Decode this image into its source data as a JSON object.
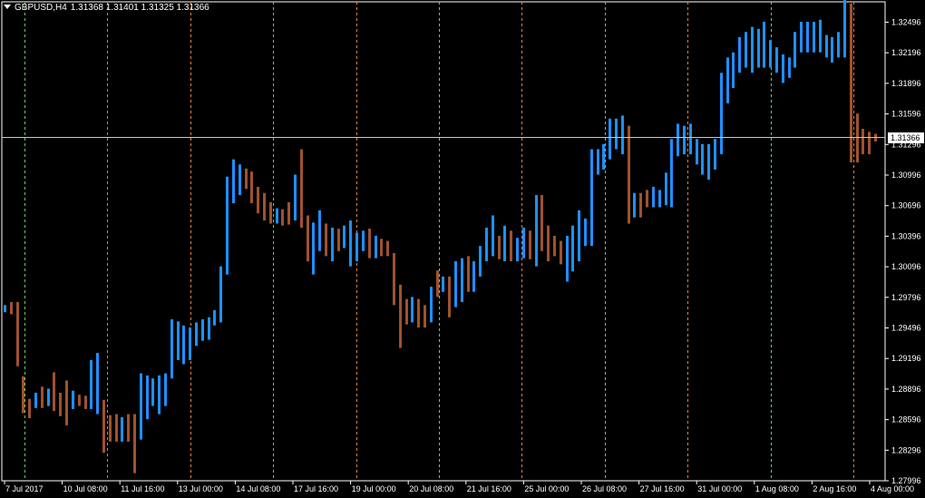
{
  "window": {
    "symbol": "GBPUSD,H4",
    "ohlc_label": "1.31368 1.31401 1.31325 1.31366"
  },
  "current_price": "1.31366",
  "colors": {
    "background": "#000000",
    "bull": "#1E90FF",
    "bear": "#A0522D",
    "axis": "#FFFFFF",
    "separator_green": "#66CC66",
    "separator_orange": "#E08040"
  },
  "chart_data": {
    "type": "ohlc-bars",
    "symbol": "GBPUSD",
    "timeframe": "H4",
    "ylim": [
      1.27996,
      1.32696
    ],
    "y_ticks": [
      "1.32496",
      "1.32196",
      "1.31896",
      "1.31596",
      "1.31296",
      "1.30996",
      "1.30696",
      "1.30396",
      "1.30096",
      "1.29796",
      "1.29496",
      "1.29196",
      "1.28896",
      "1.28596",
      "1.28296",
      "1.27996"
    ],
    "x_ticks": [
      "7 Jul 2017",
      "10 Jul 08:00",
      "11 Jul 16:00",
      "13 Jul 00:00",
      "14 Jul 08:00",
      "17 Jul 16:00",
      "19 Jul 00:00",
      "20 Jul 08:00",
      "21 Jul 16:00",
      "25 Jul 00:00",
      "26 Jul 08:00",
      "27 Jul 16:00",
      "31 Jul 00:00",
      "1 Aug 08:00",
      "2 Aug 16:00",
      "4 Aug 00:00"
    ],
    "separators": [
      "green",
      "orange",
      "orange",
      "green",
      "orange",
      "green",
      "orange",
      "green",
      "orange",
      "green",
      "orange"
    ],
    "bars": [
      [
        1.2965,
        1.2972,
        1.2965,
        1.2972
      ],
      [
        1.2971,
        1.2975,
        1.2963,
        1.2968
      ],
      [
        1.297,
        1.2975,
        1.2912,
        1.2913
      ],
      [
        1.29,
        1.2902,
        1.2866,
        1.2873
      ],
      [
        1.2875,
        1.288,
        1.2861,
        1.2867
      ],
      [
        1.2874,
        1.2886,
        1.2871,
        1.2881
      ],
      [
        1.2883,
        1.2892,
        1.2871,
        1.2877
      ],
      [
        1.288,
        1.289,
        1.2873,
        1.2885
      ],
      [
        1.289,
        1.2906,
        1.2868,
        1.2875
      ],
      [
        1.287,
        1.2886,
        1.2863,
        1.2865
      ],
      [
        1.2885,
        1.2898,
        1.2854,
        1.2868
      ],
      [
        1.2875,
        1.2888,
        1.287,
        1.2882
      ],
      [
        1.288,
        1.2884,
        1.2873,
        1.2878
      ],
      [
        1.2878,
        1.2883,
        1.287,
        1.2876
      ],
      [
        1.2872,
        1.2918,
        1.287,
        1.291
      ],
      [
        1.287,
        1.2925,
        1.2865,
        1.2915
      ],
      [
        1.2872,
        1.2879,
        1.2827,
        1.2836
      ],
      [
        1.2855,
        1.2864,
        1.2838,
        1.2842
      ],
      [
        1.2856,
        1.2865,
        1.2838,
        1.2845
      ],
      [
        1.2848,
        1.2862,
        1.2838,
        1.2852
      ],
      [
        1.286,
        1.2865,
        1.2838,
        1.2848
      ],
      [
        1.286,
        1.2865,
        1.2807,
        1.283
      ],
      [
        1.2845,
        1.2905,
        1.284,
        1.29
      ],
      [
        1.2865,
        1.2903,
        1.286,
        1.2895
      ],
      [
        1.288,
        1.29,
        1.2873,
        1.2895
      ],
      [
        1.2875,
        1.2903,
        1.2865,
        1.2893
      ],
      [
        1.288,
        1.2905,
        1.2873,
        1.2898
      ],
      [
        1.2905,
        1.2958,
        1.29,
        1.295
      ],
      [
        1.2935,
        1.2956,
        1.2918,
        1.2943
      ],
      [
        1.293,
        1.2952,
        1.2914,
        1.2948
      ],
      [
        1.2925,
        1.295,
        1.2918,
        1.2945
      ],
      [
        1.294,
        1.2955,
        1.2932,
        1.295
      ],
      [
        1.294,
        1.2958,
        1.2937,
        1.2952
      ],
      [
        1.2942,
        1.296,
        1.2938,
        1.2956
      ],
      [
        1.2955,
        1.2967,
        1.2952,
        1.2962
      ],
      [
        1.296,
        1.301,
        1.2955,
        1.3005
      ],
      [
        1.301,
        1.3098,
        1.3002,
        1.3092
      ],
      [
        1.308,
        1.3115,
        1.3072,
        1.3106
      ],
      [
        1.309,
        1.311,
        1.308,
        1.31
      ],
      [
        1.3095,
        1.3106,
        1.3086,
        1.3093
      ],
      [
        1.309,
        1.3103,
        1.3072,
        1.3076
      ],
      [
        1.3078,
        1.3088,
        1.3062,
        1.3074
      ],
      [
        1.3075,
        1.3082,
        1.3055,
        1.306
      ],
      [
        1.3062,
        1.3073,
        1.3052,
        1.3058
      ],
      [
        1.3058,
        1.3067,
        1.3052,
        1.3062
      ],
      [
        1.306,
        1.3066,
        1.305,
        1.3054
      ],
      [
        1.3057,
        1.3073,
        1.3051,
        1.3056
      ],
      [
        1.306,
        1.31,
        1.3055,
        1.3095
      ],
      [
        1.31,
        1.3125,
        1.3048,
        1.3055
      ],
      [
        1.3045,
        1.306,
        1.3015,
        1.3018
      ],
      [
        1.303,
        1.3053,
        1.3002,
        1.3045
      ],
      [
        1.304,
        1.3065,
        1.3025,
        1.305
      ],
      [
        1.3045,
        1.3052,
        1.302,
        1.303
      ],
      [
        1.3035,
        1.3048,
        1.3015,
        1.304
      ],
      [
        1.304,
        1.3047,
        1.3025,
        1.303
      ],
      [
        1.303,
        1.305,
        1.3028,
        1.3045
      ],
      [
        1.304,
        1.3055,
        1.301,
        1.304
      ],
      [
        1.3035,
        1.3043,
        1.3015,
        1.3035
      ],
      [
        1.3035,
        1.3045,
        1.3025,
        1.304
      ],
      [
        1.304,
        1.3047,
        1.3018,
        1.3028
      ],
      [
        1.302,
        1.304,
        1.3018,
        1.3035
      ],
      [
        1.303,
        1.3037,
        1.302,
        1.3025
      ],
      [
        1.303,
        1.3035,
        1.302,
        1.3028
      ],
      [
        1.3015,
        1.3023,
        1.2972,
        1.298
      ],
      [
        1.2975,
        1.2992,
        1.293,
        1.296
      ],
      [
        1.2965,
        1.2978,
        1.2953,
        1.296
      ],
      [
        1.296,
        1.298,
        1.2955,
        1.2975
      ],
      [
        1.297,
        1.2978,
        1.295,
        1.2953
      ],
      [
        1.2965,
        1.2972,
        1.295,
        1.296
      ],
      [
        1.2965,
        1.299,
        1.2955,
        1.2988
      ],
      [
        1.2995,
        1.3006,
        1.298,
        1.299
      ],
      [
        1.299,
        1.3,
        1.2985,
        1.2995
      ],
      [
        1.299,
        1.3,
        1.296,
        1.2985
      ],
      [
        1.2975,
        1.3015,
        1.297,
        1.301
      ],
      [
        1.2985,
        1.3018,
        1.2975,
        1.3013
      ],
      [
        1.301,
        1.302,
        1.2985,
        1.3005
      ],
      [
        1.2995,
        1.3015,
        1.2985,
        1.301
      ],
      [
        1.3005,
        1.303,
        1.3,
        1.302
      ],
      [
        1.302,
        1.3048,
        1.3015,
        1.304
      ],
      [
        1.303,
        1.306,
        1.302,
        1.305
      ],
      [
        1.303,
        1.304,
        1.3017,
        1.3025
      ],
      [
        1.3025,
        1.305,
        1.3015,
        1.304
      ],
      [
        1.303,
        1.3045,
        1.3015,
        1.3025
      ],
      [
        1.3028,
        1.3038,
        1.3015,
        1.303
      ],
      [
        1.3025,
        1.3048,
        1.3018,
        1.3045
      ],
      [
        1.3035,
        1.3045,
        1.3017,
        1.3025
      ],
      [
        1.303,
        1.308,
        1.301,
        1.307
      ],
      [
        1.305,
        1.308,
        1.3025,
        1.3045
      ],
      [
        1.304,
        1.305,
        1.3015,
        1.3035
      ],
      [
        1.303,
        1.304,
        1.302,
        1.3025
      ],
      [
        1.3025,
        1.3035,
        1.3012,
        1.3018
      ],
      [
        1.302,
        1.304,
        1.2995,
        1.303
      ],
      [
        1.3015,
        1.305,
        1.3005,
        1.3045
      ],
      [
        1.303,
        1.3065,
        1.3015,
        1.3055
      ],
      [
        1.304,
        1.3057,
        1.303,
        1.3045
      ],
      [
        1.304,
        1.3125,
        1.303,
        1.312
      ],
      [
        1.311,
        1.3125,
        1.31,
        1.3115
      ],
      [
        1.311,
        1.313,
        1.3105,
        1.312
      ],
      [
        1.312,
        1.3155,
        1.3115,
        1.315
      ],
      [
        1.313,
        1.3155,
        1.3125,
        1.314
      ],
      [
        1.3125,
        1.3158,
        1.312,
        1.3145
      ],
      [
        1.3145,
        1.3148,
        1.3052,
        1.306
      ],
      [
        1.3065,
        1.3082,
        1.3058,
        1.3075
      ],
      [
        1.307,
        1.3082,
        1.3058,
        1.3065
      ],
      [
        1.308,
        1.3085,
        1.3068,
        1.3075
      ],
      [
        1.307,
        1.3088,
        1.3068,
        1.308
      ],
      [
        1.3075,
        1.3085,
        1.3068,
        1.3077
      ],
      [
        1.308,
        1.3102,
        1.307,
        1.309
      ],
      [
        1.308,
        1.3135,
        1.3068,
        1.313
      ],
      [
        1.313,
        1.315,
        1.3118,
        1.314
      ],
      [
        1.313,
        1.3148,
        1.312,
        1.3135
      ],
      [
        1.3125,
        1.315,
        1.312,
        1.314
      ],
      [
        1.312,
        1.3135,
        1.311,
        1.3125
      ],
      [
        1.3115,
        1.313,
        1.31,
        1.3115
      ],
      [
        1.3105,
        1.313,
        1.3095,
        1.312
      ],
      [
        1.311,
        1.3135,
        1.3105,
        1.313
      ],
      [
        1.313,
        1.32,
        1.312,
        1.3195
      ],
      [
        1.3175,
        1.3215,
        1.317,
        1.3205
      ],
      [
        1.319,
        1.322,
        1.3185,
        1.321
      ],
      [
        1.3205,
        1.3235,
        1.32,
        1.3225
      ],
      [
        1.321,
        1.324,
        1.3205,
        1.323
      ],
      [
        1.3215,
        1.3245,
        1.32,
        1.3225
      ],
      [
        1.321,
        1.3243,
        1.3205,
        1.323
      ],
      [
        1.3215,
        1.325,
        1.3205,
        1.3235
      ],
      [
        1.321,
        1.3232,
        1.3205,
        1.322
      ],
      [
        1.321,
        1.3225,
        1.32,
        1.3215
      ],
      [
        1.3205,
        1.3218,
        1.319,
        1.321
      ],
      [
        1.3205,
        1.3215,
        1.3195,
        1.321
      ],
      [
        1.321,
        1.324,
        1.3205,
        1.323
      ],
      [
        1.3225,
        1.325,
        1.322,
        1.324
      ],
      [
        1.323,
        1.325,
        1.322,
        1.324
      ],
      [
        1.323,
        1.325,
        1.322,
        1.324
      ],
      [
        1.323,
        1.3252,
        1.322,
        1.324
      ],
      [
        1.3225,
        1.3237,
        1.3215,
        1.3225
      ],
      [
        1.322,
        1.3235,
        1.321,
        1.3222
      ],
      [
        1.322,
        1.324,
        1.3215,
        1.323
      ],
      [
        1.3225,
        1.3275,
        1.3215,
        1.327
      ],
      [
        1.326,
        1.3268,
        1.3112,
        1.3125
      ],
      [
        1.315,
        1.316,
        1.3112,
        1.313
      ],
      [
        1.314,
        1.3145,
        1.312,
        1.313
      ],
      [
        1.3138,
        1.3142,
        1.312,
        1.3132
      ],
      [
        1.31368,
        1.31401,
        1.31325,
        1.31366
      ]
    ]
  }
}
